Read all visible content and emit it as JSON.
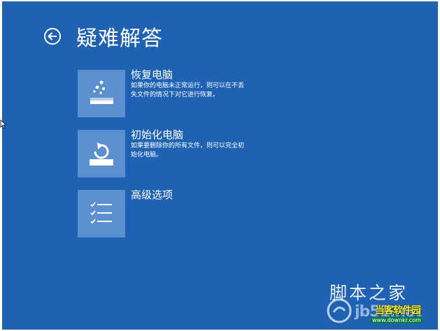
{
  "header": {
    "title": "疑难解答",
    "back_icon": "back-arrow-circle-icon"
  },
  "options": [
    {
      "title": "恢复电脑",
      "desc": "如果你的电脑未正常运行，则可以在不丢失文件的情况下对它进行恢复。",
      "icon": "refresh-pc-icon"
    },
    {
      "title": "初始化电脑",
      "desc": "如果要删除你的所有文件，则可以完全初始化电脑。",
      "icon": "reset-pc-icon"
    },
    {
      "title": "高级选项",
      "icon": "checklist-icon"
    }
  ],
  "watermark": {
    "jb51": "脚本之家",
    "domain": "jb51.net",
    "brand": "当客软件园",
    "url": "www.downkr.com"
  },
  "colors": {
    "background": "#1f62b3",
    "tile": "#5b8fcf",
    "text": "#ffffff"
  }
}
